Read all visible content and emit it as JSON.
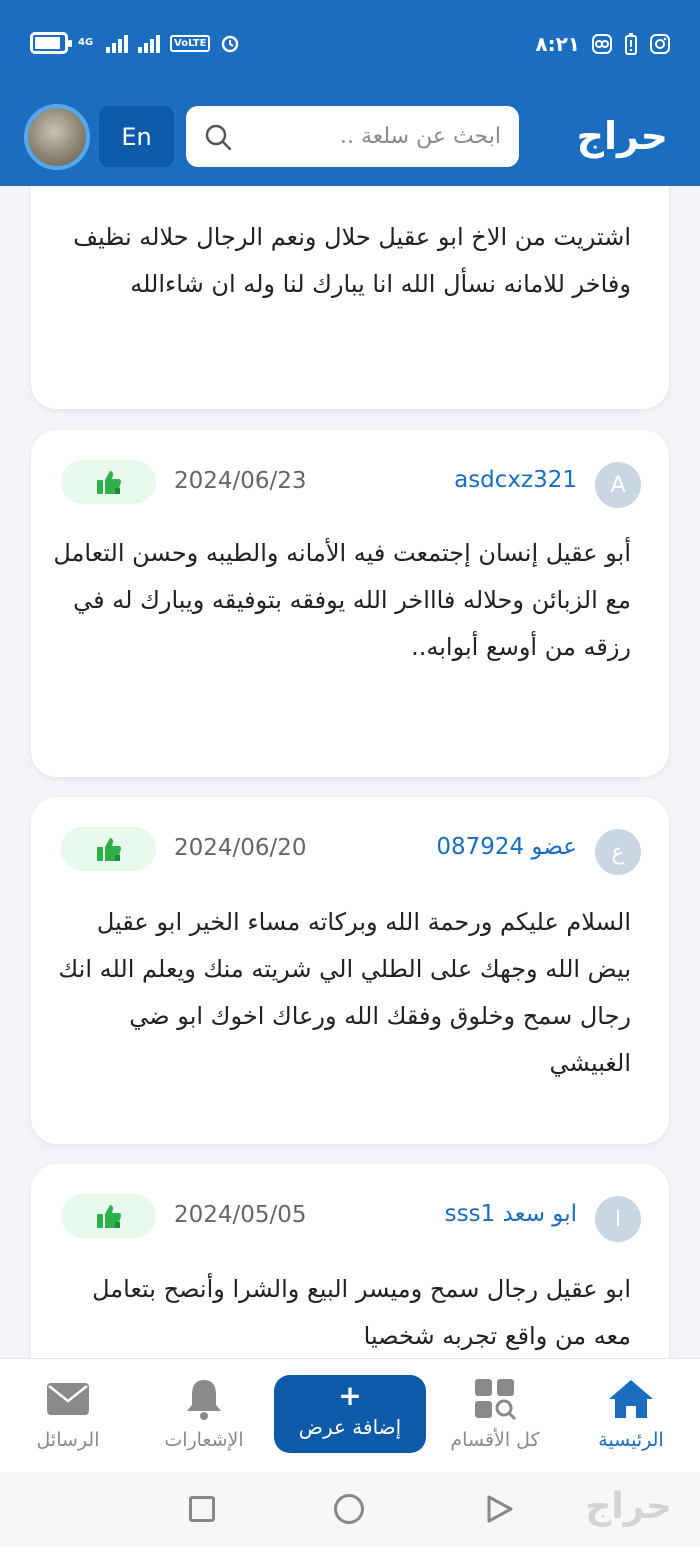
{
  "status_bar": {
    "network_type": "4G",
    "volte_label": "VoLTE",
    "time": "٨:٢١",
    "battery_level": 0.9
  },
  "header": {
    "logo_text": "حراج",
    "search_placeholder": "ابحث عن سلعة ..",
    "lang_button": "En"
  },
  "reviews": [
    {
      "text": "اشتريت من الاخ ابو عقيل حلال ونعم الرجال حلاله نظيف وفاخر للامانه نسأل الله انا يبارك لنا وله ان شاءالله"
    },
    {
      "avatar_letter": "A",
      "username": "asdcxz321",
      "date": "2024/06/23",
      "text": "أبو عقيل إنسان إجتمعت فيه الأمانه والطيبه وحسن التعامل مع الزبائن وحلاله فاااخر الله يوفقه بتوفيقه ويبارك له في رزقه من أوسع أبوابه.."
    },
    {
      "avatar_letter": "ع",
      "username": "عضو 087924",
      "date": "2024/06/20",
      "text": "السلام عليكم ورحمة الله وبركاته مساء الخير ابو عقيل بيض الله وجهك على الطلي الي شريته منك ويعلم الله انك رجال سمح وخلوق وفقك الله ورعاك اخوك ابو ضي الغبيشي"
    },
    {
      "avatar_letter": "ا",
      "username": "ابو سعد sss1",
      "date": "2024/05/05",
      "text": "ابو عقيل رجال سمح وميسر البيع والشرا وأنصح بتعامل معه من واقع تجربه شخصيا"
    }
  ],
  "bottom_nav": {
    "home": "الرئيسية",
    "categories": "كل الأقسام",
    "add_plus": "+",
    "add_offer": "إضافة عرض",
    "notifications": "الإشعارات",
    "messages": "الرسائل"
  },
  "watermark": "حراج",
  "colors": {
    "primary": "#1a6dbf",
    "primary_dark": "#0c5aa8",
    "like_green": "#2eb04a",
    "like_bg": "#e6f9ec"
  }
}
